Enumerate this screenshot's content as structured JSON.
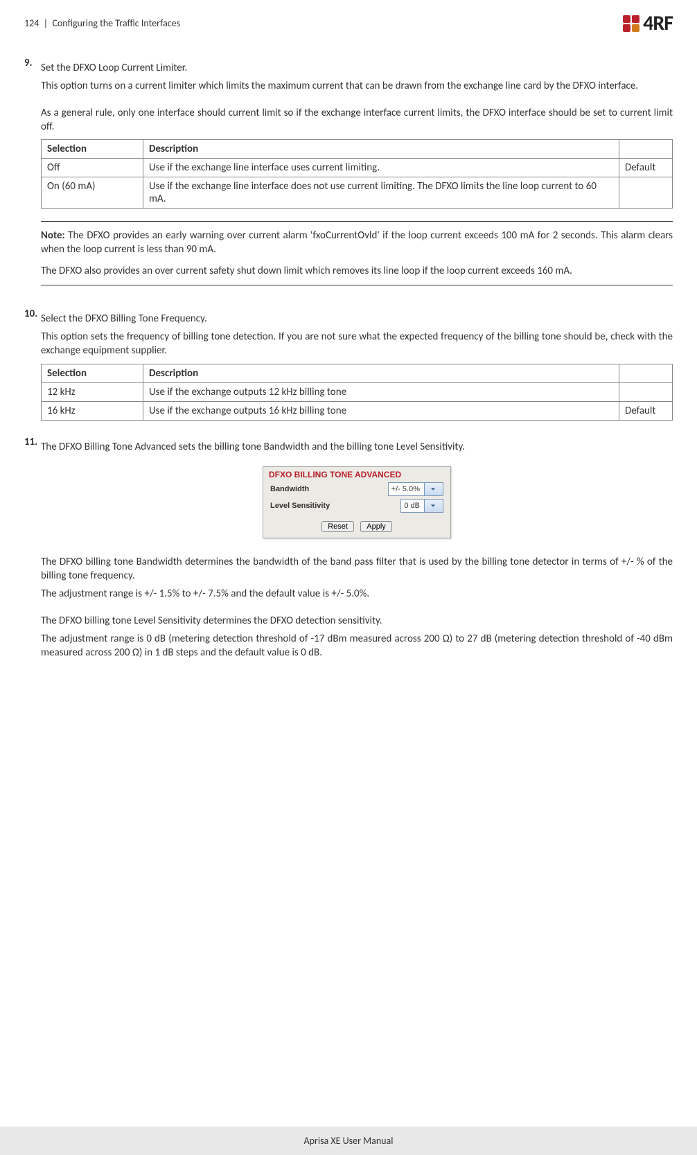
{
  "header": {
    "page_num": "124",
    "sep": "|",
    "section": "Configuring the Traffic Interfaces",
    "logo_text": "4RF"
  },
  "step9": {
    "num": "9.",
    "title": "Set the DFXO Loop Current Limiter.",
    "p1": "This option turns on a current limiter which limits the maximum current that can be drawn from the exchange line card by the DFXO interface.",
    "p2": "As a general rule, only one interface should current limit so if the exchange interface current limits, the DFXO interface should be set to current limit off.",
    "table": {
      "h1": "Selection",
      "h2": "Description",
      "r1c1": "Off",
      "r1c2": "Use if the exchange line interface uses current limiting.",
      "r1c3": "Default",
      "r2c1": "On (60 mA)",
      "r2c2": "Use if the exchange line interface does not use current limiting. The DFXO limits the line loop current to 60 mA.",
      "r2c3": ""
    },
    "note_label": "Note:",
    "note_p1": " The DFXO provides an early warning over current alarm 'fxoCurrentOvld' if the loop current exceeds 100 mA for 2 seconds. This alarm clears when the loop current is less than 90 mA.",
    "note_p2": "The DFXO also provides an over current safety shut down limit which removes its line loop if the loop current exceeds 160 mA."
  },
  "step10": {
    "num": "10.",
    "title": "Select the DFXO Billing Tone Frequency.",
    "p1": "This option sets the frequency of billing tone detection. If you are not sure what the expected frequency of the billing tone should be, check with the exchange equipment supplier.",
    "table": {
      "h1": "Selection",
      "h2": "Description",
      "r1c1": "12 kHz",
      "r1c2": "Use if the exchange outputs 12 kHz billing tone",
      "r1c3": "",
      "r2c1": "16 kHz",
      "r2c2": "Use if the exchange outputs 16 kHz billing tone",
      "r2c3": "Default"
    }
  },
  "step11": {
    "num": "11.",
    "title": "The DFXO Billing Tone Advanced sets the billing tone Bandwidth and the billing tone Level Sensitivity.",
    "widget": {
      "title": "DFXO BILLING TONE ADVANCED",
      "row1_label": "Bandwidth",
      "row1_value": "+/- 5.0%",
      "row2_label": "Level Sensitivity",
      "row2_value": "0 dB",
      "reset": "Reset",
      "apply": "Apply"
    },
    "p1": "The DFXO billing tone Bandwidth determines the bandwidth of the band pass filter that is used by the billing tone detector in terms of +/- % of the billing tone frequency.",
    "p2": "The adjustment range is +/- 1.5% to +/- 7.5% and the default value is +/- 5.0%.",
    "p3": "The DFXO billing tone Level Sensitivity determines the DFXO detection sensitivity.",
    "p4": "The adjustment range is 0 dB (metering detection threshold of -17 dBm measured across 200 Ω) to 27 dB (metering detection threshold of -40 dBm measured across 200 Ω) in 1 dB steps and the default value is 0 dB."
  },
  "footer": {
    "text": "Aprisa XE User Manual"
  }
}
